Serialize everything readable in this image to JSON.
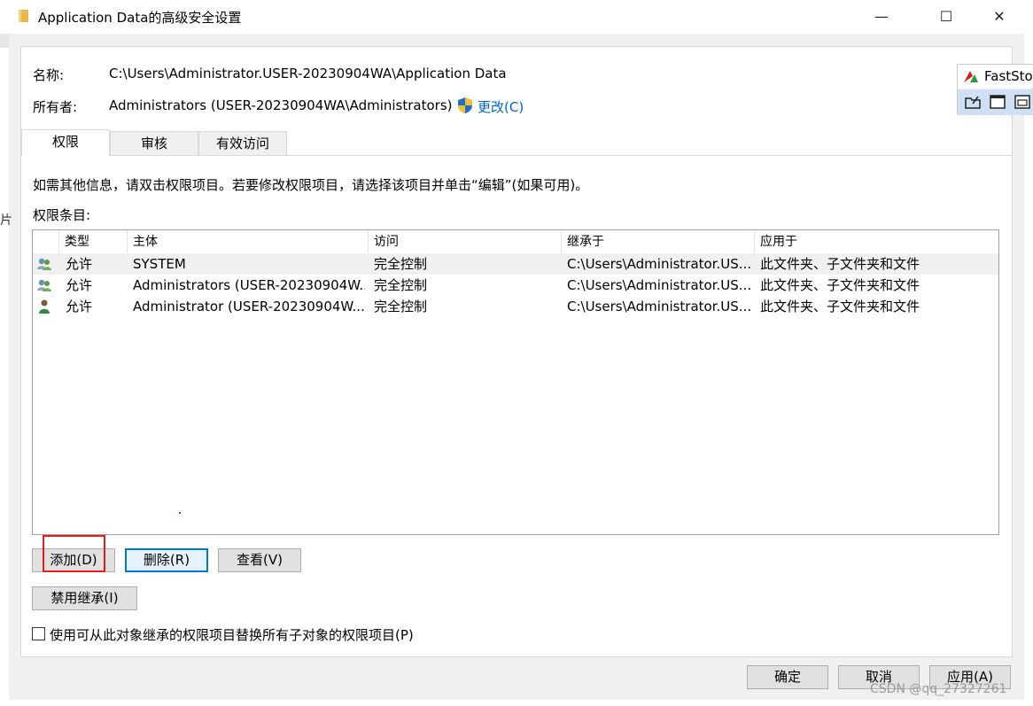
{
  "window": {
    "title": "Application Data的高级安全设置",
    "minimize_glyph": "—",
    "maximize_glyph": "☐",
    "close_glyph": "✕"
  },
  "info": {
    "name_label": "名称:",
    "name_value": "C:\\Users\\Administrator.USER-20230904WA\\Application Data",
    "owner_label": "所有者:",
    "owner_value": "Administrators (USER-20230904WA\\Administrators)",
    "change_link": "更改(C)"
  },
  "tabs": [
    {
      "label": "权限"
    },
    {
      "label": "审核"
    },
    {
      "label": "有效访问"
    }
  ],
  "instructions": "如需其他信息，请双击权限项目。若要修改权限项目，请选择该项目并单击“编辑”(如果可用)。",
  "entries_label": "权限条目:",
  "table": {
    "headers": [
      "类型",
      "主体",
      "访问",
      "继承于",
      "应用于"
    ],
    "rows": [
      {
        "icon": "user-group-icon",
        "type": "允许",
        "principal": "SYSTEM",
        "access": "完全控制",
        "inherited": "C:\\Users\\Administrator.US...",
        "applies": "此文件夹、子文件夹和文件"
      },
      {
        "icon": "user-group-icon",
        "type": "允许",
        "principal": "Administrators (USER-20230904W...",
        "access": "完全控制",
        "inherited": "C:\\Users\\Administrator.US...",
        "applies": "此文件夹、子文件夹和文件"
      },
      {
        "icon": "user-icon",
        "type": "允许",
        "principal": "Administrator (USER-20230904W...",
        "access": "完全控制",
        "inherited": "C:\\Users\\Administrator.US...",
        "applies": "此文件夹、子文件夹和文件"
      }
    ]
  },
  "buttons": {
    "add": "添加(D)",
    "remove": "删除(R)",
    "view": "查看(V)",
    "disable_inheritance": "禁用继承(I)",
    "ok": "确定",
    "cancel": "取消",
    "apply": "应用(A)"
  },
  "replace_checkbox": {
    "label": "使用可从此对象继承的权限项目替换所有子对象的权限项目(P)",
    "checked": false
  },
  "faststone": {
    "title": "FastSto"
  },
  "side_glyph": "片",
  "watermark": "CSDN @qq_27327261",
  "colors": {
    "accent": "#0078d7",
    "link": "#0066cc",
    "highlight_box": "#e81e1e",
    "selected_row": "#f0f0f0"
  }
}
